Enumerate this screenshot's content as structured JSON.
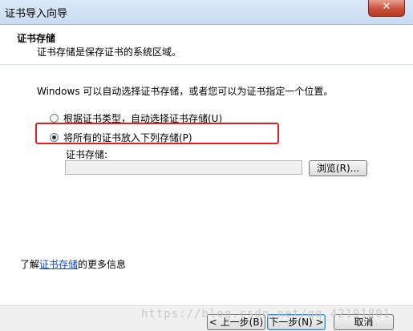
{
  "window": {
    "title": "证书导入向导",
    "close_label": "✕"
  },
  "header": {
    "title": "证书存储",
    "subtitle": "证书存储是保存证书的系统区域。"
  },
  "content": {
    "description": "Windows 可以自动选择证书存储，或者您可以为证书指定一个位置。",
    "options": [
      {
        "label": "根据证书类型，自动选择证书存储(U)",
        "checked": false
      },
      {
        "label": "将所有的证书放入下列存储(P)",
        "checked": true
      }
    ],
    "store_label": "证书存储:",
    "store_value": "",
    "browse_label": "浏览(R)...",
    "more_info": {
      "prefix": "了解",
      "link": "证书存储",
      "suffix": "的更多信息"
    }
  },
  "footer": {
    "back_label": "< 上一步(B)",
    "next_label": "下一步(N) >",
    "cancel_label": "取消"
  },
  "watermark": "https://blog.csdn.net/qq_42191801",
  "colors": {
    "highlight": "#e02020",
    "link": "#0a4ac4"
  }
}
